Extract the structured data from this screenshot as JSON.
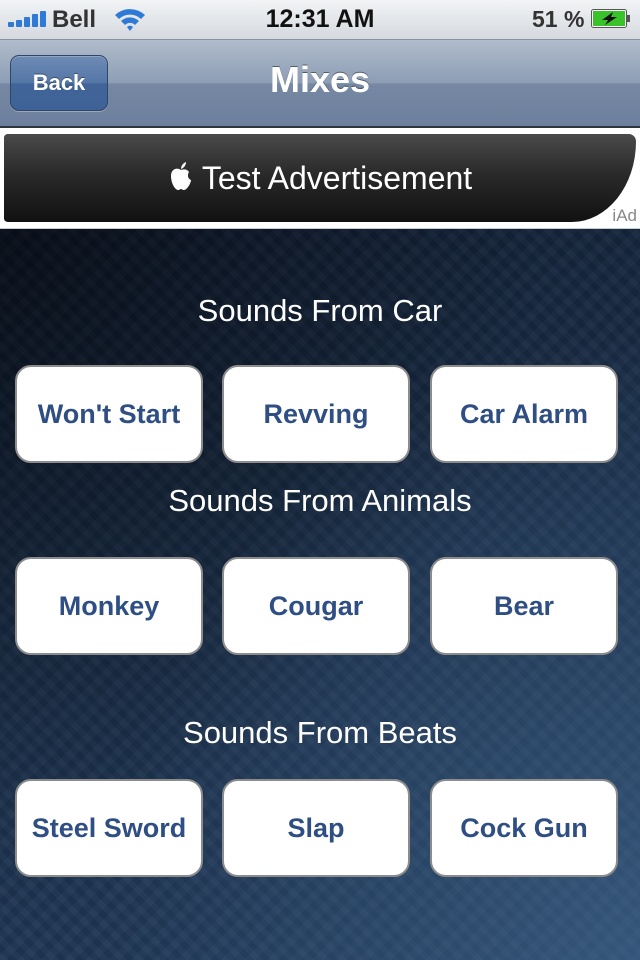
{
  "status_bar": {
    "carrier": "Bell",
    "time": "12:31 AM",
    "battery_percent": "51 %",
    "icons": [
      "signal-bars-icon",
      "wifi-icon",
      "battery-charging-icon"
    ],
    "signal_bars": 5,
    "battery_level": 0.51
  },
  "nav": {
    "back_label": "Back",
    "title": "Mixes"
  },
  "ad": {
    "text": "Test Advertisement",
    "icon": "apple-logo-icon",
    "badge": "iAd"
  },
  "sections": [
    {
      "title": "Sounds From Car",
      "buttons": [
        "Won't Start",
        "Revving",
        "Car Alarm"
      ]
    },
    {
      "title": "Sounds From Animals",
      "buttons": [
        "Monkey",
        "Cougar",
        "Bear"
      ]
    },
    {
      "title": "Sounds From Beats",
      "buttons": [
        "Steel Sword",
        "Slap",
        "Cock Gun"
      ]
    }
  ],
  "colors": {
    "button_text": "#2f4f84",
    "nav_bar": "#8d9db4",
    "back_button": "#4a6da0",
    "signal": "#2e7ad6",
    "battery_fill": "#39c22a"
  }
}
